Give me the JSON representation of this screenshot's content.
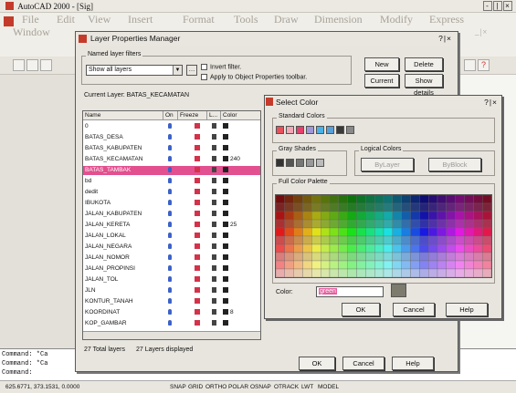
{
  "app": {
    "title": "AutoCAD 2000 - [Sig]",
    "window_buttons": [
      "-",
      "|",
      "×"
    ]
  },
  "menu": [
    "File",
    "Edit",
    "View",
    "Insert",
    "Format",
    "Tools",
    "Draw",
    "Dimension",
    "Modify",
    "Express",
    "Window"
  ],
  "mdi_buttons": "_|×",
  "layer_dialog": {
    "title": "Layer Properties Manager",
    "help_buttons": "?|×",
    "named_filters_label": "Named layer filters",
    "filter_value": "Show all layers",
    "invert_filter": "Invert filter.",
    "apply_toolbar": "Apply to Object Properties toolbar.",
    "buttons": {
      "new": "New",
      "delete": "Delete",
      "current": "Current",
      "show_details": "Show details"
    },
    "current_layer_label": "Current Layer:  BATAS_KECAMATAN",
    "columns": [
      "Name",
      "On",
      "Freeze",
      "L...",
      "Color"
    ],
    "layers": [
      {
        "name": "0",
        "color_num": ""
      },
      {
        "name": "BATAS_DESA",
        "color_num": ""
      },
      {
        "name": "BATAS_KABUPATEN",
        "color_num": ""
      },
      {
        "name": "BATAS_KECAMATAN",
        "color_num": "240"
      },
      {
        "name": "BATAS_TAMBAK",
        "color_num": "",
        "selected": true
      },
      {
        "name": "bd",
        "color_num": ""
      },
      {
        "name": "dedit",
        "color_num": ""
      },
      {
        "name": "IBUKOTA",
        "color_num": ""
      },
      {
        "name": "JALAN_KABUPATEN",
        "color_num": ""
      },
      {
        "name": "JALAN_KERETA",
        "color_num": "25"
      },
      {
        "name": "JALAN_LOKAL",
        "color_num": ""
      },
      {
        "name": "JALAN_NEGARA",
        "color_num": ""
      },
      {
        "name": "JALAN_NOMOR",
        "color_num": ""
      },
      {
        "name": "JALAN_PROPINSI",
        "color_num": ""
      },
      {
        "name": "JALAN_TOL",
        "color_num": ""
      },
      {
        "name": "JLN",
        "color_num": ""
      },
      {
        "name": "KONTUR_TANAH",
        "color_num": ""
      },
      {
        "name": "KOORDINAT",
        "color_num": "8"
      },
      {
        "name": "KOP_GAMBAR",
        "color_num": ""
      }
    ],
    "total_layers": "27 Total layers",
    "displayed_layers": "27 Layers displayed",
    "ok": "OK",
    "cancel": "Cancel",
    "help": "Help"
  },
  "color_dialog": {
    "title": "Select Color",
    "help_buttons": "?|×",
    "standard_colors": "Standard Colors",
    "gray_shades": "Gray Shades",
    "logical_colors": "Logical Colors",
    "bylayer": "ByLayer",
    "byblock": "ByBlock",
    "full_palette": "Full Color Palette",
    "color_label": "Color:",
    "color_value": "green",
    "ok": "OK",
    "cancel": "Cancel",
    "help": "Help"
  },
  "command_lines": [
    "Command:  *Ca",
    "Command:  *Ca",
    "Command:"
  ],
  "status": {
    "coords": "625.6771, 373.1531, 0.0000",
    "modes": [
      "SNAP",
      "GRID",
      "ORTHO",
      "POLAR",
      "OSNAP",
      "OTRACK",
      "LWT",
      "MODEL"
    ]
  },
  "colors": {
    "selected_row": "#e2508f",
    "standard": [
      "#e8505a",
      "#f2a6b6",
      "#e6406e",
      "#9f98d8",
      "#4ab1e8",
      "#58a0d8",
      "#3a3a3a",
      "#888888"
    ],
    "gray": [
      "#333333",
      "#555555",
      "#777777",
      "#999999",
      "#bbbbbb"
    ]
  }
}
